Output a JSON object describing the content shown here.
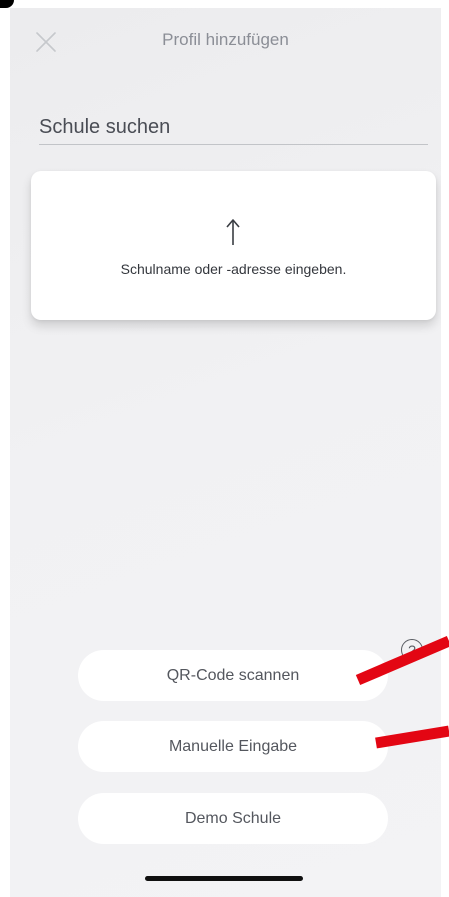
{
  "header": {
    "title": "Profil hinzufügen",
    "close_icon": "close-icon"
  },
  "search": {
    "placeholder": "Schule suchen",
    "value": ""
  },
  "hint": {
    "icon": "arrow-up-icon",
    "text": "Schulname oder -adresse eingeben."
  },
  "actions": {
    "qr_label": "QR-Code scannen",
    "manual_label": "Manuelle Eingabe",
    "demo_label": "Demo Schule",
    "help_symbol": "?"
  },
  "colors": {
    "background": "#f0f0f2",
    "card": "#ffffff",
    "title": "#8b8e96",
    "annotation_arrow": "#e30613"
  }
}
